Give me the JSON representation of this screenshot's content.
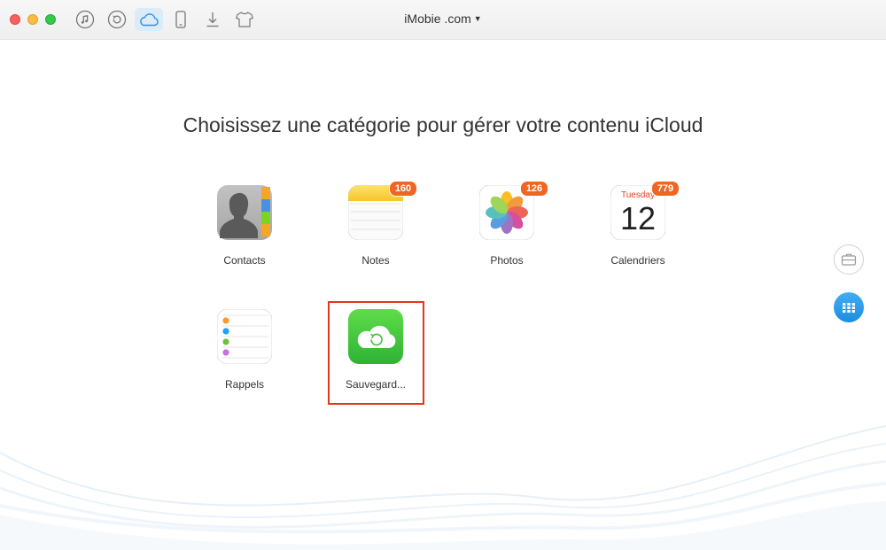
{
  "window": {
    "device_name": "iMobie .com"
  },
  "toolbar": {
    "items": [
      {
        "icon": "music-note-icon",
        "active": false
      },
      {
        "icon": "restore-icon",
        "active": false
      },
      {
        "icon": "icloud-icon",
        "active": true
      },
      {
        "icon": "phone-icon",
        "active": false
      },
      {
        "icon": "download-icon",
        "active": false
      },
      {
        "icon": "tshirt-icon",
        "active": false
      }
    ]
  },
  "main": {
    "heading": "Choisissez une catégorie pour gérer votre contenu iCloud",
    "categories": [
      {
        "label": "Contacts",
        "icon": "contacts-icon",
        "badge": ""
      },
      {
        "label": "Notes",
        "icon": "notes-icon",
        "badge": "160"
      },
      {
        "label": "Photos",
        "icon": "photos-icon",
        "badge": "126"
      },
      {
        "label": "Calendriers",
        "icon": "calendar-icon",
        "badge": "779",
        "calendar_day": "Tuesday",
        "calendar_date": "12"
      },
      {
        "label": "Rappels",
        "icon": "reminders-icon",
        "badge": ""
      },
      {
        "label": "Sauvegard...",
        "icon": "icloud-backup-icon",
        "badge": "",
        "selected": true
      }
    ]
  },
  "sidebar": {
    "buttons": [
      {
        "icon": "toolbox-icon"
      },
      {
        "icon": "grid-icon"
      }
    ]
  },
  "colors": {
    "accent": "#1c8ee0",
    "badge": "#f06522",
    "highlight": "#e2371f",
    "backup_green": "#3fc23a"
  }
}
